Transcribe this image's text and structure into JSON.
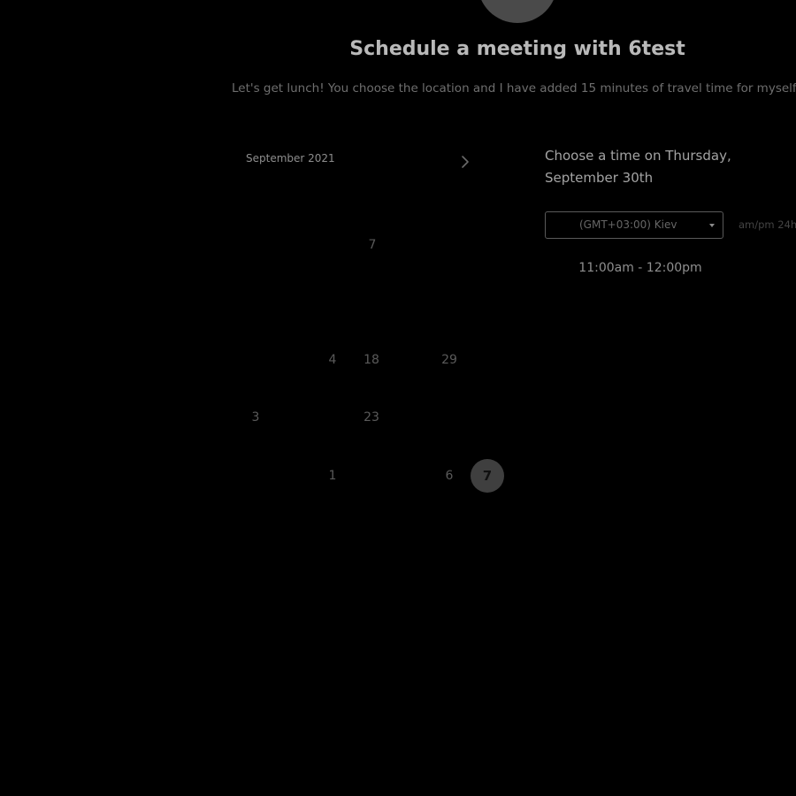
{
  "page": {
    "title": "Schedule a meeting with 6test",
    "description": "Let's get lunch! You choose the location and I have added 15 minutes of travel time for myself"
  },
  "calendar": {
    "month_label": "September 2021",
    "next_icon": "chevron-right-icon",
    "days": [
      {
        "label": "7"
      },
      {
        "label": "4"
      },
      {
        "label": "18"
      },
      {
        "label": "29"
      },
      {
        "label": "3"
      },
      {
        "label": "23"
      },
      {
        "label": "1"
      },
      {
        "label": "6"
      },
      {
        "label": "7",
        "selected": true
      }
    ]
  },
  "timepicker": {
    "heading": "Choose a time on Thursday, September 30th",
    "timezone": "(GMT+03:00) Kiev",
    "format_toggle": "am/pm 24h",
    "slots": [
      "11:00am - 12:00pm"
    ]
  },
  "colors": {
    "background": "#000000",
    "selected_day": "#3f3f3f"
  }
}
